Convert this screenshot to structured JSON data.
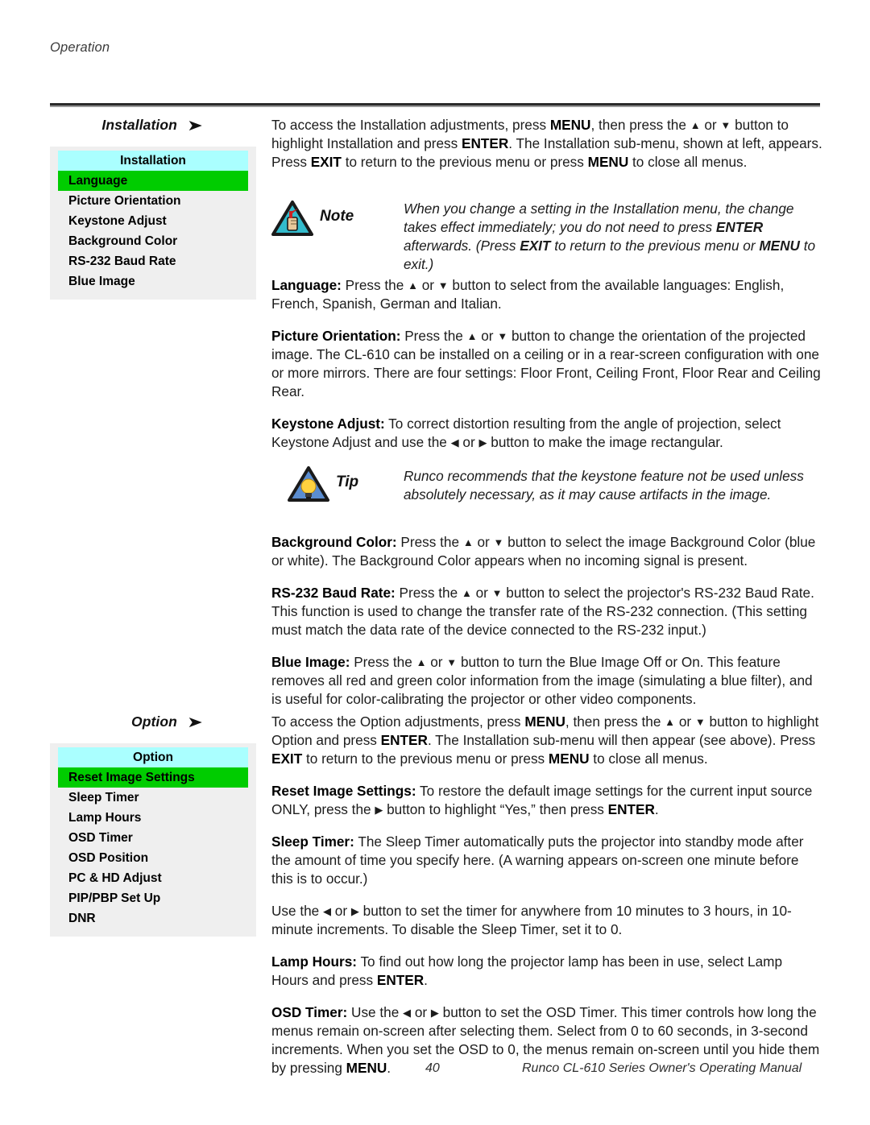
{
  "page": {
    "running_head": "Operation",
    "page_number": "40",
    "manual_title": "Runco CL-610 Series Owner's Operating Manual"
  },
  "colors": {
    "osd_title_bg": "#AAFFFF",
    "osd_selected_bg": "#00CC00",
    "osd_panel_bg": "#EFEFEF",
    "note_triangle_fill": "#33BBCC",
    "tip_triangle_fill": "#5B8DD0",
    "tip_bulb_fill": "#FFD23F"
  },
  "sections": {
    "installation": {
      "label": "Installation",
      "arrow_icon": "right-arrow-icon",
      "intro": {
        "t1": "To access the Installation adjustments, press ",
        "b1": "MENU",
        "t2": ", then press the ",
        "up": "▲",
        "t3": " or ",
        "down": "▼",
        "t4": " button to highlight Installation and press ",
        "b2": "ENTER",
        "t5": ". The Installation sub-menu, shown at left, appears. Press ",
        "b3": "EXIT",
        "t6": " to return to the previous menu or press ",
        "b4": "MENU",
        "t7": " to close all menus."
      },
      "osd": {
        "title": "Installation",
        "items": [
          {
            "label": "Language",
            "selected": true
          },
          {
            "label": "Picture Orientation",
            "selected": false
          },
          {
            "label": "Keystone Adjust",
            "selected": false
          },
          {
            "label": "Background Color",
            "selected": false
          },
          {
            "label": "RS-232 Baud Rate",
            "selected": false
          },
          {
            "label": "Blue Image",
            "selected": false
          }
        ]
      },
      "note": {
        "word": "Note",
        "icon": "note-warning-triangle-icon",
        "t1": "When you change a setting in the Installation menu, the change takes effect immediately; you do not need to press ",
        "b1": "ENTER",
        "t2": " afterwards. (Press ",
        "b2": "EXIT",
        "t3": " to return to the previous menu or ",
        "b3": "MENU",
        "t4": " to exit.)"
      },
      "paragraphs": {
        "language": {
          "heading": "Language:",
          "t1": " Press the ",
          "up": "▲",
          "t2": " or ",
          "down": "▼",
          "t3": " button to select from the available languages: English, French, Spanish, German and Italian."
        },
        "picture_orientation": {
          "heading": "Picture Orientation:",
          "t1": " Press the ",
          "up": "▲",
          "t2": " or ",
          "down": "▼",
          "t3": " button to change the orientation of the projected image. The CL-610 can be installed on a ceiling or in a rear-screen configuration with one or more mirrors. There are four settings: Floor Front, Ceiling Front, Floor Rear and Ceiling Rear."
        },
        "keystone_adjust": {
          "heading": "Keystone Adjust:",
          "t1": " To correct distortion resulting from the angle of projection, select Keystone Adjust and use the ",
          "left": "◀",
          "t2": " or ",
          "right": "▶",
          "t3": " button to make the image rectangular."
        },
        "background_color": {
          "heading": "Background Color:",
          "t1": " Press the ",
          "up": "▲",
          "t2": " or ",
          "down": "▼",
          "t3": " button to select the image Background Color (blue or white). The Background Color appears when no incoming signal is present."
        },
        "rs232_baud_rate": {
          "heading": "RS-232 Baud Rate:",
          "t1": " Press the ",
          "up": "▲",
          "t2": " or ",
          "down": "▼",
          "t3": " button to select the projector's RS-232 Baud Rate. This function is used to change the transfer rate of the RS-232 connection. (This setting must match the data rate of the device connected to the RS-232 input.)"
        },
        "blue_image": {
          "heading": "Blue Image:",
          "t1": " Press the ",
          "up": "▲",
          "t2": " or ",
          "down": "▼",
          "t3": " button to turn the Blue Image Off or On. This feature removes all red and green color information from the image (simulating a blue filter), and is useful for color-calibrating the projector or other video components."
        }
      },
      "tip": {
        "word": "Tip",
        "icon": "tip-lightbulb-triangle-icon",
        "text": "Runco recommends that the keystone feature not be used unless absolutely necessary, as it may cause artifacts in the image."
      }
    },
    "option": {
      "label": "Option",
      "arrow_icon": "right-arrow-icon",
      "intro": {
        "t1": "To access the Option adjustments, press ",
        "b1": "MENU",
        "t2": ", then press the ",
        "up": "▲",
        "t3": " or ",
        "down": "▼",
        "t4": " button to highlight Option and press ",
        "b2": "ENTER",
        "t5": ". The Installation sub-menu will then appear (see above). Press ",
        "b3": "EXIT",
        "t6": " to return to the previous menu or press ",
        "b4": "MENU",
        "t7": " to close all menus."
      },
      "osd": {
        "title": "Option",
        "items": [
          {
            "label": "Reset Image Settings",
            "selected": true
          },
          {
            "label": "Sleep Timer",
            "selected": false
          },
          {
            "label": "Lamp Hours",
            "selected": false
          },
          {
            "label": "OSD Timer",
            "selected": false
          },
          {
            "label": "OSD Position",
            "selected": false
          },
          {
            "label": "PC & HD Adjust",
            "selected": false
          },
          {
            "label": "PIP/PBP Set Up",
            "selected": false
          },
          {
            "label": "DNR",
            "selected": false
          }
        ]
      },
      "paragraphs": {
        "reset_image_settings": {
          "heading": "Reset Image Settings:",
          "t1": " To restore the default image settings for the current input source ONLY, press the ",
          "right": "▶",
          "t2": " button to highlight “Yes,” then press ",
          "b1": "ENTER",
          "t3": "."
        },
        "sleep_timer": {
          "heading": "Sleep Timer:",
          "t1": " The Sleep Timer automatically puts the projector into standby mode after the amount of time you specify here. (A warning appears on-screen one minute before this is to occur.)"
        },
        "sleep_timer_use": {
          "t1": "Use the ",
          "left": "◀",
          "t2": " or ",
          "right": "▶",
          "t3": " button to set the timer for anywhere from 10 minutes to 3 hours, in 10-minute increments. To disable the Sleep Timer, set it to 0."
        },
        "lamp_hours": {
          "heading": "Lamp Hours:",
          "t1": " To find out how long the projector lamp has been in use, select Lamp Hours and press ",
          "b1": "ENTER",
          "t2": "."
        },
        "osd_timer": {
          "heading": "OSD Timer:",
          "t1": " Use the ",
          "left": "◀",
          "t2": " or ",
          "right": "▶",
          "t3": " button to set the OSD Timer. This timer controls how long the menus remain on-screen after selecting them. Select from 0 to 60 seconds, in 3-second increments. When you set the OSD to 0, the menus remain on-screen until you hide them by pressing ",
          "b1": "MENU",
          "t4": "."
        }
      }
    }
  }
}
